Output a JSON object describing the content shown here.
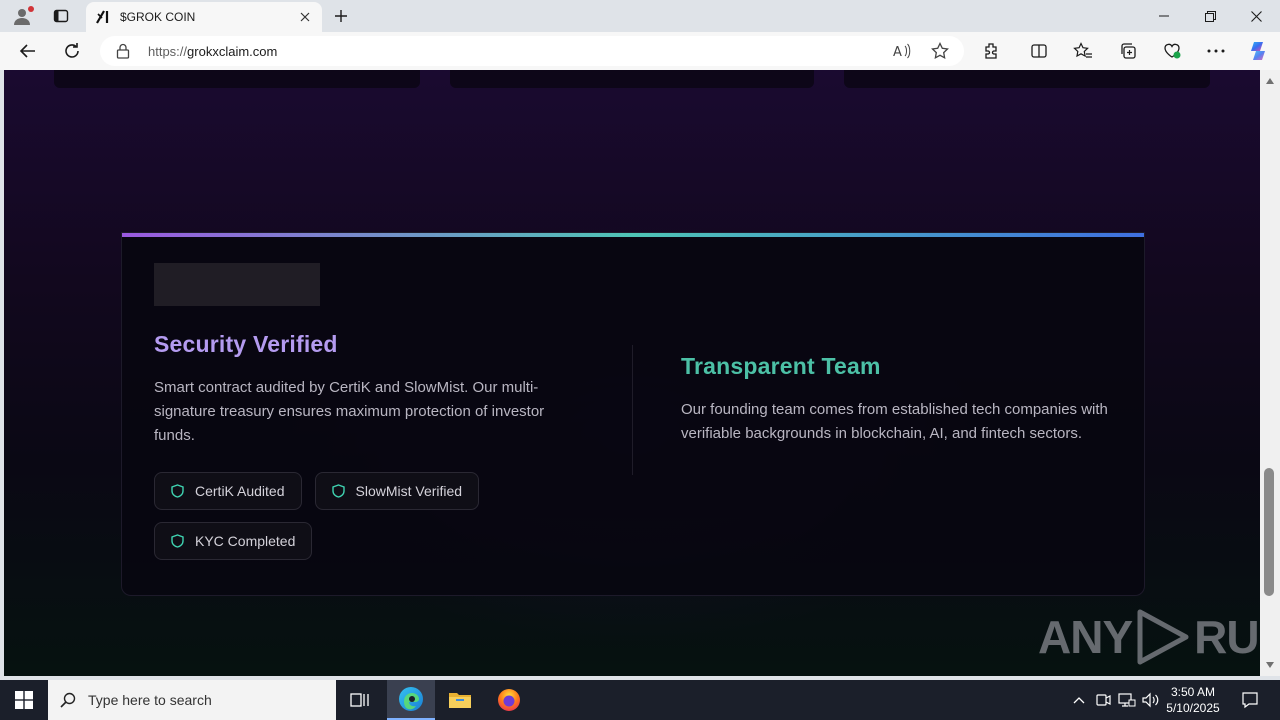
{
  "browser": {
    "tab_title": "$GROK COIN",
    "url_host": "grokxclaim.com",
    "url_prefix": "https://"
  },
  "page": {
    "security": {
      "title": "Security Verified",
      "description": "Smart contract audited by CertiK and SlowMist. Our multi-signature treasury ensures maximum protection of investor funds.",
      "badges": [
        "CertiK Audited",
        "SlowMist Verified",
        "KYC Completed"
      ]
    },
    "team": {
      "title": "Transparent Team",
      "description": "Our founding team comes from established tech companies with verifiable backgrounds in blockchain, AI, and fintech sectors."
    },
    "watermark_left": "ANY",
    "watermark_right": "RUN"
  },
  "taskbar": {
    "search_placeholder": "Type here to search",
    "time": "3:50 AM",
    "date": "5/10/2025"
  },
  "colors": {
    "accent_purple": "#b49bf0",
    "accent_teal": "#4cc0a6",
    "gradient_start": "#9b59e0",
    "gradient_mid": "#4ec4b5",
    "gradient_end": "#3f6fe0"
  },
  "icons": [
    "profile-icon",
    "tab-actions-icon",
    "grok-favicon",
    "close-icon",
    "new-tab-icon",
    "minimize-icon",
    "restore-icon",
    "window-close-icon",
    "back-icon",
    "refresh-icon",
    "lock-icon",
    "read-aloud-icon",
    "favorite-star-icon",
    "extensions-icon",
    "split-screen-icon",
    "favorites-icon",
    "collections-icon",
    "browser-essentials-icon",
    "more-icon",
    "copilot-icon",
    "shield-icon",
    "windows-start-icon",
    "search-icon",
    "task-view-icon",
    "edge-icon",
    "file-explorer-icon",
    "firefox-icon",
    "chevron-up-icon",
    "network-icon",
    "volume-icon",
    "notification-icon"
  ]
}
